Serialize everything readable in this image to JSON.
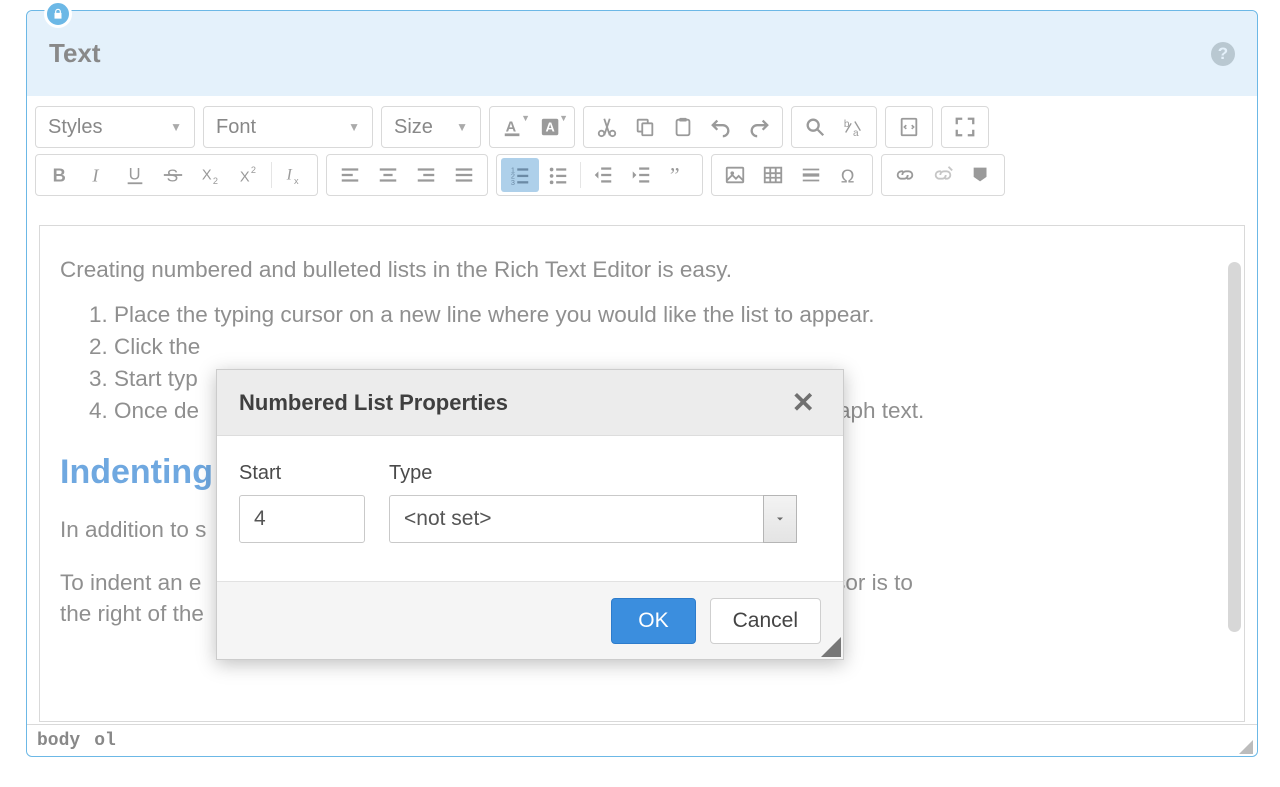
{
  "panel": {
    "title": "Text"
  },
  "toolbar": {
    "styles_label": "Styles",
    "font_label": "Font",
    "size_label": "Size"
  },
  "content": {
    "intro": "Creating numbered and bulleted lists in the Rich Text Editor is easy.",
    "list": [
      "Place the typing cursor on a new line where you would like the list to appear.",
      "Click the                                                                    ",
      "Start typ                                                                     the next.",
      "Once de                                                                       ck to regular paragraph text."
    ],
    "heading": "Indenting",
    "para1": "In addition to s                                                                so indent sub-lists.",
    "para2a": "To indent an e                                                                   3 when the typing cursor is to",
    "para2b": "the right of the                                                                 t a sub-bullet, press"
  },
  "dialog": {
    "title": "Numbered List Properties",
    "start_label": "Start",
    "start_value": "4",
    "type_label": "Type",
    "type_value": "<not set>",
    "ok_label": "OK",
    "cancel_label": "Cancel"
  },
  "footer": {
    "path1": "body",
    "path2": "ol"
  }
}
